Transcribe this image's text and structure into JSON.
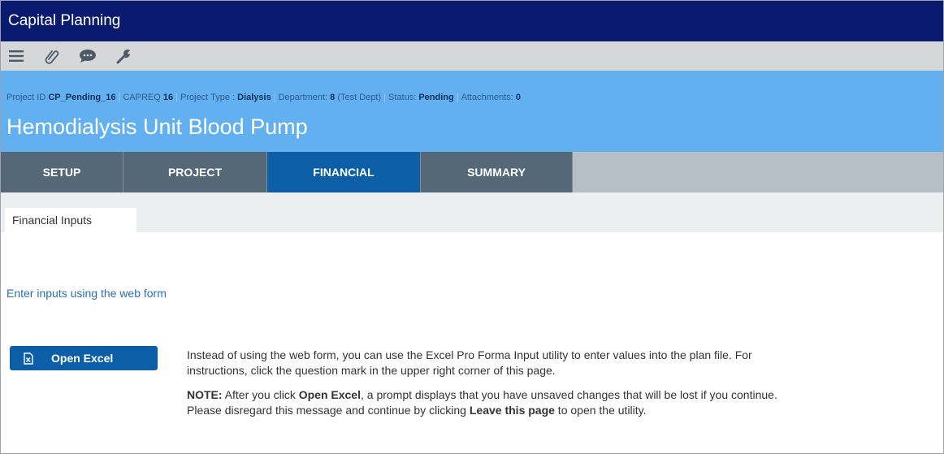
{
  "window": {
    "title": "Capital Planning"
  },
  "toolbar": {
    "icons": [
      "menu-icon",
      "paperclip-icon",
      "chat-icon",
      "wrench-icon"
    ]
  },
  "header": {
    "meta": {
      "project_id_label": "Project ID",
      "project_id_value": "CP_Pending_16",
      "capreq_label": "CAPREQ",
      "capreq_value": "16",
      "project_type_label": "Project Type :",
      "project_type_value": "Dialysis",
      "department_label": "Department:",
      "department_value": "8",
      "department_name": "(Test Dept)",
      "status_label": "Status:",
      "status_value": "Pending",
      "attachments_label": "Attachments:",
      "attachments_value": "0"
    },
    "project_title": "Hemodialysis Unit Blood Pump"
  },
  "tabs": [
    {
      "label": "SETUP",
      "active": false
    },
    {
      "label": "PROJECT",
      "active": false
    },
    {
      "label": "FINANCIAL",
      "active": true
    },
    {
      "label": "SUMMARY",
      "active": false
    }
  ],
  "subtab": {
    "label": "Financial Inputs"
  },
  "main": {
    "web_form_link": "Enter inputs using the web form",
    "open_excel_label": "Open Excel",
    "instructions": "Instead of using the web form, you can use the Excel Pro Forma Input utility to enter values into the plan file. For instructions, click the question mark in the upper right corner of this page.",
    "note_label": "NOTE:",
    "note_part1": " After you click ",
    "note_open_excel": "Open Excel",
    "note_part2": ", a prompt displays that you have unsaved changes that will be lost if you continue. Please disregard this message and continue by clicking ",
    "note_leave": "Leave this page",
    "note_part3": " to open the utility."
  },
  "colors": {
    "titlebar": "#0a1a6e",
    "header": "#62b0f0",
    "tab": "#546877",
    "tab_active": "#0c5fa6",
    "link": "#2a6fb3"
  }
}
